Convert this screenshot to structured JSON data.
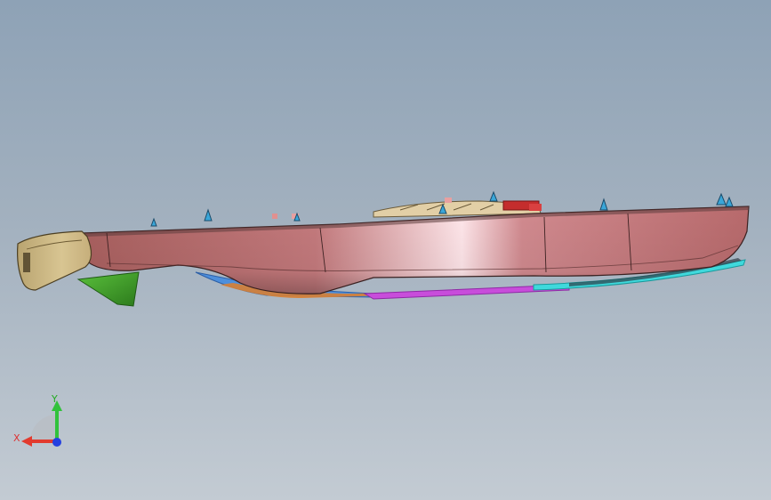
{
  "viewport": {
    "background_top": "#8ea2b6",
    "background_bottom": "#c3cbd3"
  },
  "model": {
    "hull_color": "#c7777b",
    "stern_color": "#cdb785",
    "keel_fin_color": "#3f9a2b",
    "bottom_accent_colors": [
      "#3b82d6",
      "#c54bd6",
      "#34d4d4"
    ]
  },
  "triad": {
    "x_label": "X",
    "y_label": "Y",
    "x_color": "#e23b2e",
    "y_color": "#31c23b",
    "z_color": "#2440e0"
  }
}
